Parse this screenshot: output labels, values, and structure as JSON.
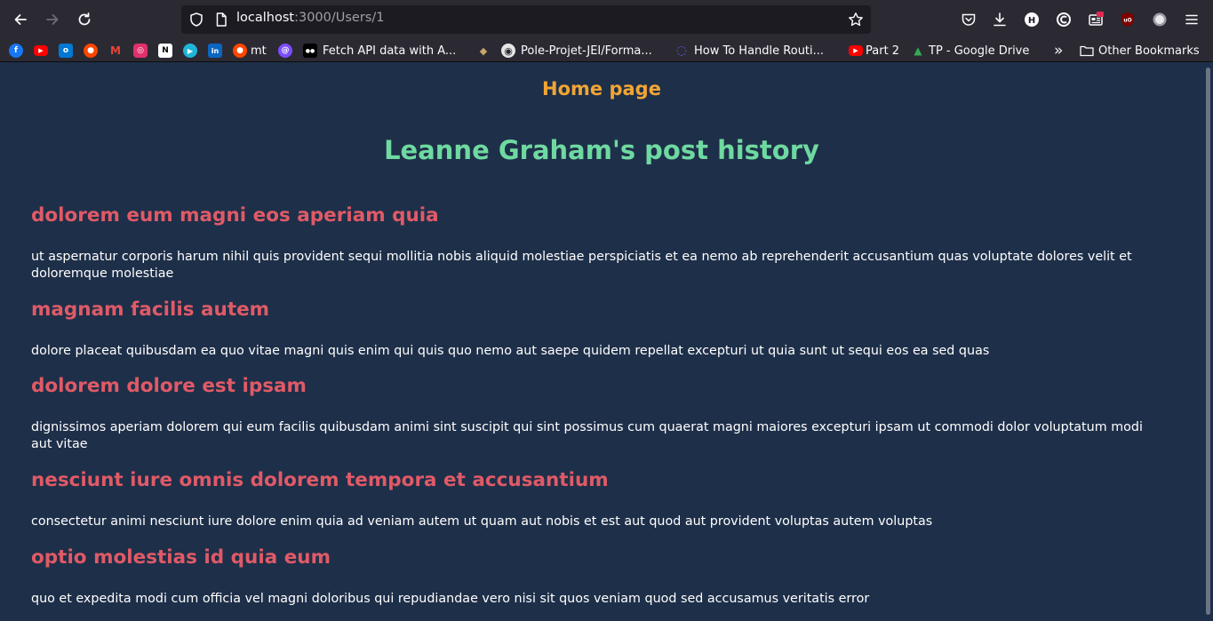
{
  "browser": {
    "url_host": "localhost",
    "url_rest": ":3000/Users/1"
  },
  "bookmarks": [
    {
      "icon": "facebook-icon",
      "label": "",
      "color": "#1877f2",
      "glyph": "f"
    },
    {
      "icon": "youtube-icon",
      "label": "",
      "color": "#ff0000",
      "glyph": "▶"
    },
    {
      "icon": "outlook-icon",
      "label": "",
      "color": "#0078d4",
      "glyph": "o"
    },
    {
      "icon": "reddit-icon",
      "label": "",
      "color": "#ff4500",
      "glyph": "●"
    },
    {
      "icon": "gmail-icon",
      "label": "",
      "color": "#ea4335",
      "glyph": "M"
    },
    {
      "icon": "instagram-icon",
      "label": "",
      "color": "#e1306c",
      "glyph": "◎"
    },
    {
      "icon": "notion-icon",
      "label": "",
      "color": "#ffffff",
      "glyph": "N"
    },
    {
      "icon": "play-icon",
      "label": "",
      "color": "#1fb5d6",
      "glyph": "▶"
    },
    {
      "icon": "linkedin-icon",
      "label": "",
      "color": "#0a66c2",
      "glyph": "in"
    },
    {
      "icon": "reddit-icon",
      "label": "mt",
      "color": "#ff4500",
      "glyph": "●"
    },
    {
      "icon": "messenger-icon",
      "label": "",
      "color": "#7c4dff",
      "glyph": "@"
    },
    {
      "icon": "medium-icon",
      "label": "Fetch API data with A...",
      "color": "#000000",
      "glyph": "●●"
    },
    {
      "icon": "mascot-icon",
      "label": "",
      "color": "#caa56a",
      "glyph": "◆"
    },
    {
      "icon": "github-icon",
      "label": "Pole-Projet-JEI/Forma...",
      "color": "#e6e6e6",
      "glyph": "◉"
    },
    {
      "icon": "logrocket-icon",
      "label": "How To Handle Routi...",
      "color": "#5b5bd6",
      "glyph": "◌"
    },
    {
      "icon": "youtube-icon",
      "label": "Part 2",
      "color": "#ff0000",
      "glyph": "▶"
    },
    {
      "icon": "google-drive-icon",
      "label": "TP - Google Drive",
      "color": "#34a853",
      "glyph": "▲"
    }
  ],
  "bookmarks_overflow": "»",
  "other_bookmarks_label": "Other Bookmarks",
  "page": {
    "home_link": "Home page",
    "title": "Leanne Graham's post history"
  },
  "posts": [
    {
      "title": "dolorem eum magni eos aperiam quia",
      "body": "ut aspernatur corporis harum nihil quis provident sequi mollitia nobis aliquid molestiae perspiciatis et ea nemo ab reprehenderit accusantium quas voluptate dolores velit et doloremque molestiae"
    },
    {
      "title": "magnam facilis autem",
      "body": "dolore placeat quibusdam ea quo vitae magni quis enim qui quis quo nemo aut saepe quidem repellat excepturi ut quia sunt ut sequi eos ea sed quas"
    },
    {
      "title": "dolorem dolore est ipsam",
      "body": "dignissimos aperiam dolorem qui eum facilis quibusdam animi sint suscipit qui sint possimus cum quaerat magni maiores excepturi ipsam ut commodi dolor voluptatum modi aut vitae"
    },
    {
      "title": "nesciunt iure omnis dolorem tempora et accusantium",
      "body": "consectetur animi nesciunt iure dolore enim quia ad veniam autem ut quam aut nobis et est aut quod aut provident voluptas autem voluptas"
    },
    {
      "title": "optio molestias id quia eum",
      "body": "quo et expedita modi cum officia vel magni doloribus qui repudiandae vero nisi sit quos veniam quod sed accusamus veritatis error"
    }
  ],
  "colors": {
    "page_background": "#1e2f49",
    "home_link": "#f0a535",
    "page_title": "#6ed9a0",
    "post_title": "#e05a67",
    "post_body": "#ffffff"
  }
}
